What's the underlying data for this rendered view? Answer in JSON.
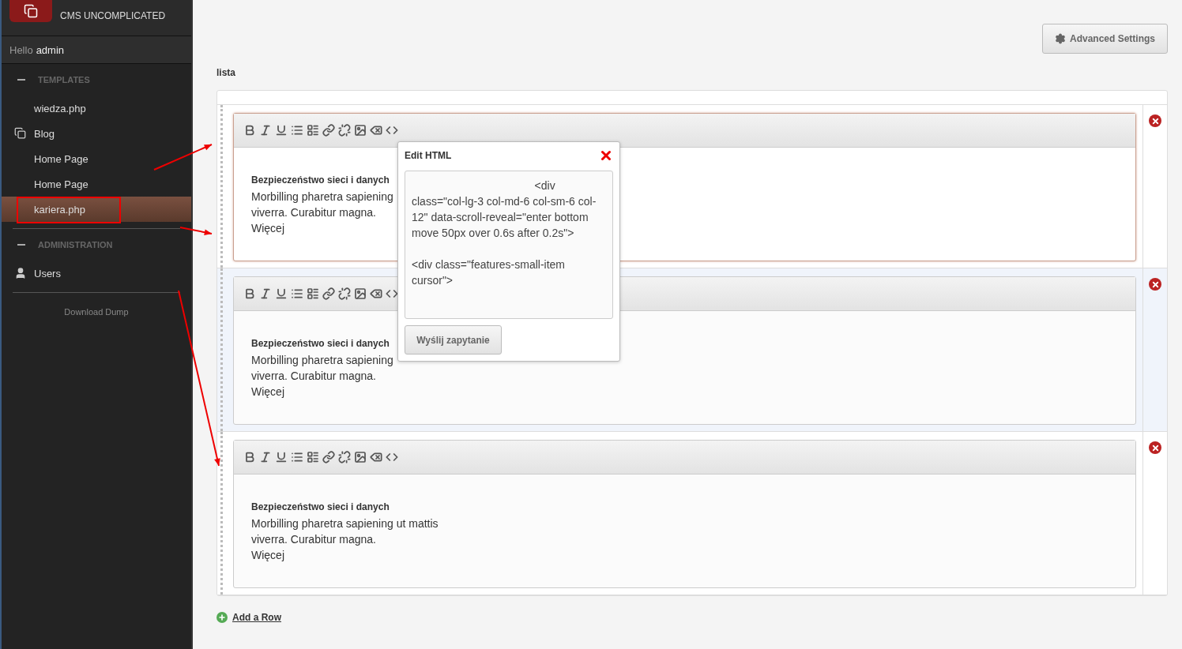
{
  "sidebar": {
    "logo_tagline": "CMS UNCOMPLICATED",
    "greeting": {
      "prefix": "Hello",
      "user": "admin"
    },
    "sections": [
      {
        "title": "TEMPLATES",
        "expanded": true,
        "items": [
          {
            "label": "wiedza.php",
            "kind": "plain",
            "selected": false
          },
          {
            "label": "Blog",
            "kind": "folder",
            "selected": false
          },
          {
            "label": "Home Page",
            "kind": "plain",
            "selected": false
          },
          {
            "label": "Home Page",
            "kind": "plain",
            "selected": false
          },
          {
            "label": "kariera.php",
            "kind": "plain",
            "selected": true
          }
        ]
      },
      {
        "title": "ADMINISTRATION",
        "expanded": true,
        "items": [
          {
            "label": "Users",
            "kind": "user",
            "selected": false
          }
        ]
      }
    ],
    "footer_link": "Download Dump"
  },
  "toolbar": {
    "advanced_button": "Advanced Settings"
  },
  "field": {
    "label": "lista",
    "rows": [
      {
        "focused": true,
        "hovered": false,
        "heading": "Bezpieczeństwo sieci i danych",
        "lines": [
          "Morbilling pharetra sapiening",
          "viverra. Curabitur magna.",
          "Więcej"
        ]
      },
      {
        "focused": false,
        "hovered": true,
        "heading": "Bezpieczeństwo sieci i danych",
        "lines": [
          "Morbilling pharetra sapiening",
          "viverra. Curabitur magna.",
          "Więcej"
        ]
      },
      {
        "focused": false,
        "hovered": false,
        "heading": "Bezpieczeństwo sieci i danych",
        "lines": [
          "Morbilling pharetra sapiening ut mattis",
          "viverra. Curabitur magna.",
          "Więcej"
        ]
      }
    ],
    "add_row": "Add a Row"
  },
  "popup": {
    "title": "Edit HTML",
    "code": "                                        <div class=\"col-lg-3 col-md-6 col-sm-6 col-12\" data-scroll-reveal=\"enter bottom move 50px over 0.6s after 0.2s\">\n\n<div class=\"features-small-item cursor\">",
    "button": "Wyślij zapytanie"
  }
}
